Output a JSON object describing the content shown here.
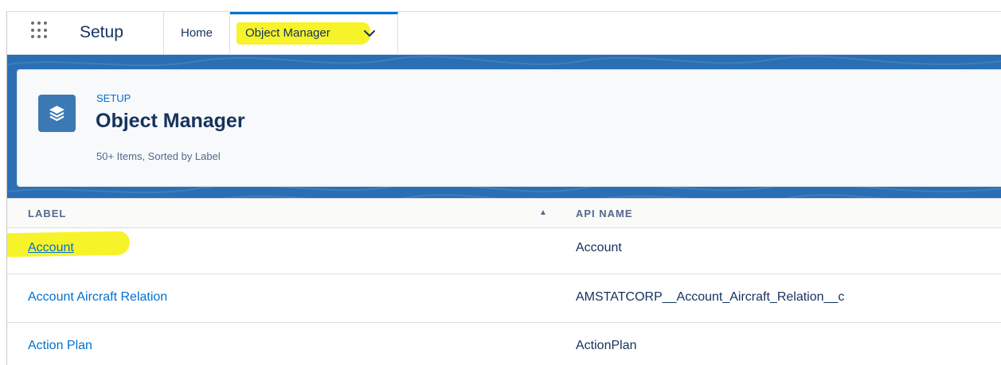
{
  "nav": {
    "app_name": "Setup",
    "tabs": [
      {
        "label": "Home"
      },
      {
        "label": "Object Manager"
      }
    ]
  },
  "header": {
    "breadcrumb": "SETUP",
    "title": "Object Manager",
    "subtitle": "50+ Items, Sorted by Label"
  },
  "table": {
    "columns": [
      {
        "label": "LABEL",
        "sort": "ascending"
      },
      {
        "label": "API NAME"
      }
    ],
    "rows": [
      {
        "label": "Account",
        "api_name": "Account"
      },
      {
        "label": "Account Aircraft Relation",
        "api_name": "AMSTATCORP__Account_Aircraft_Relation__c"
      },
      {
        "label": "Action Plan",
        "api_name": "ActionPlan"
      }
    ]
  },
  "icons": {
    "app_launcher": "waffle-grid-icon",
    "tab_menu": "chevron-down-icon",
    "object_manager": "layers-stack-icon",
    "sort": "sort-up-arrow-icon"
  },
  "colors": {
    "link": "#0070d2",
    "text": "#16325c",
    "band": "#2a6fb3",
    "highlight": "#f7f32a"
  }
}
